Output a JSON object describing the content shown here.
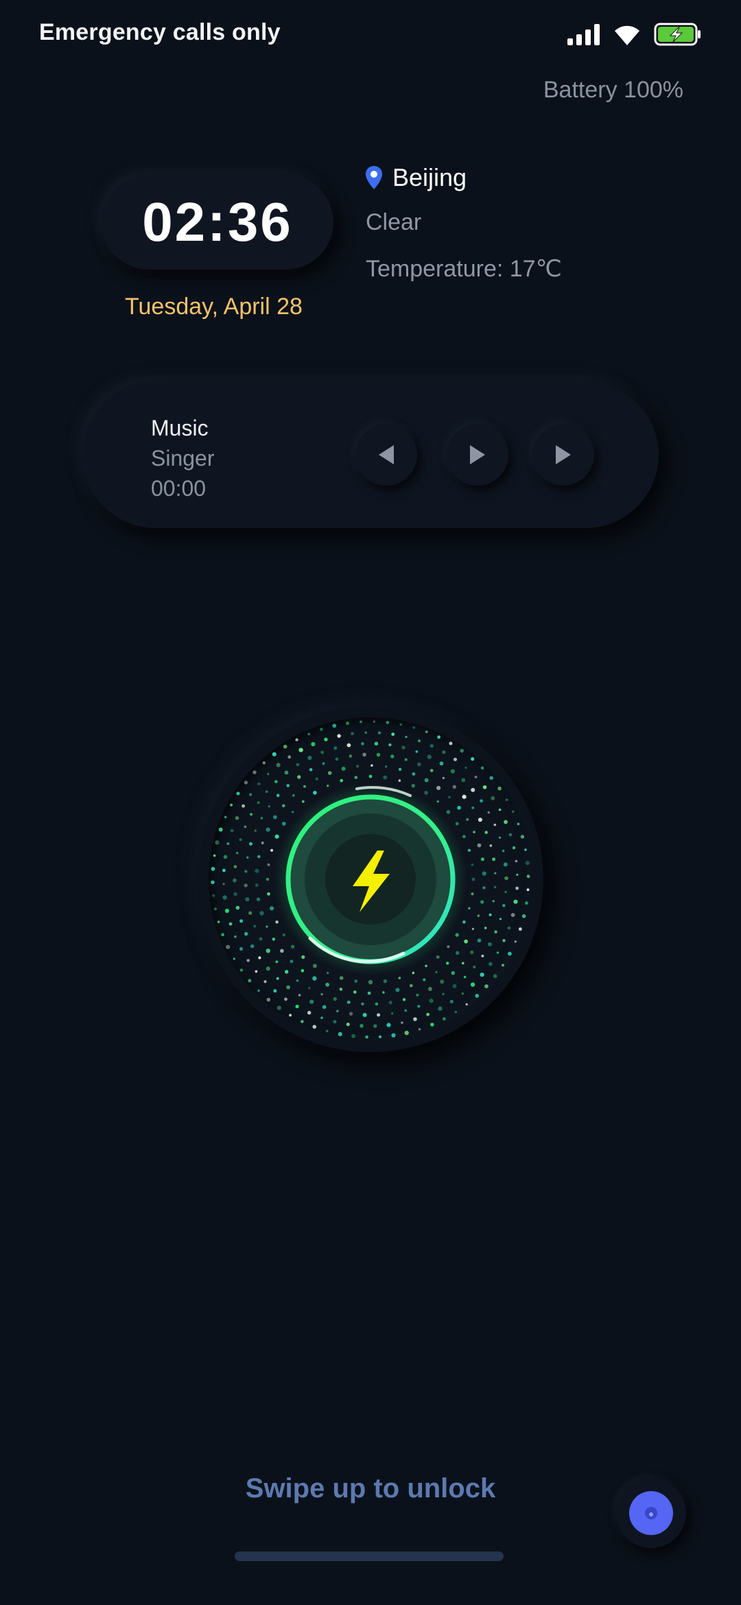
{
  "status_bar": {
    "carrier_text": "Emergency calls only",
    "icons": [
      "signal-icon",
      "wifi-icon",
      "battery-charging-icon"
    ],
    "battery_label": "Battery 100%"
  },
  "clock": {
    "time": "02:36",
    "date": "Tuesday, April 28"
  },
  "weather": {
    "location": "Beijing",
    "condition": "Clear",
    "temperature": "Temperature: 17℃",
    "icon": "location-pin-icon"
  },
  "music": {
    "title": "Music",
    "singer": "Singer",
    "time": "00:00",
    "controls": [
      "previous-icon",
      "play-icon",
      "next-icon"
    ]
  },
  "charging": {
    "icon": "lightning-bolt-icon",
    "level": 1.0
  },
  "bottom": {
    "swipe_hint": "Swipe up to unlock"
  },
  "colors": {
    "background": "#0b111a",
    "date_accent": "#f5c36b",
    "swipe_text": "#5c7ab0",
    "assist_button": "#5566f5",
    "ring_green": "#2cf27a",
    "ring_cyan": "#30e0d0",
    "bolt": "#f5f000"
  }
}
